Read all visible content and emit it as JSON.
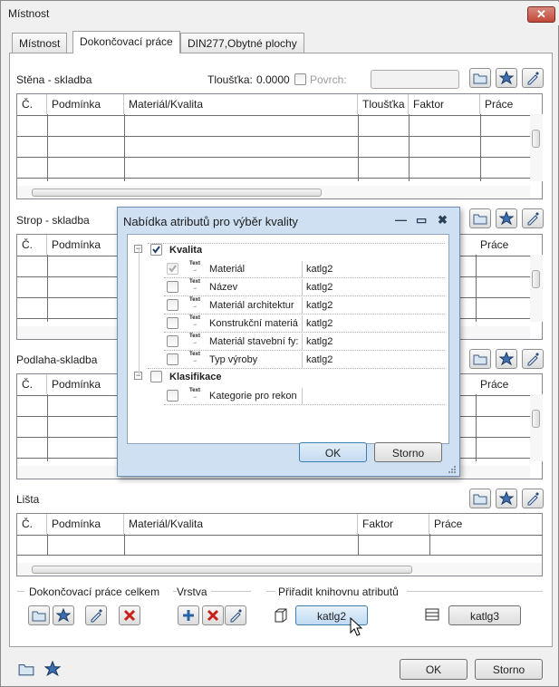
{
  "window": {
    "title": "Místnost",
    "close_glyph": "✕"
  },
  "tabs": [
    {
      "label": "Místnost",
      "active": false
    },
    {
      "label": "Dokončovací práce",
      "active": true
    },
    {
      "label": "DIN277,Obytné plochy",
      "active": false
    }
  ],
  "wall": {
    "title": "Stěna - skladba",
    "thickness_label": "Tloušťka:",
    "thickness_value": "0.0000",
    "surface_label": "Povrch:",
    "columns": [
      "Č.",
      "Podmínka",
      "Materiál/Kvalita",
      "Tloušťka",
      "Faktor",
      "Práce"
    ]
  },
  "ceiling": {
    "title": "Strop - skladba",
    "columns": [
      "Č.",
      "Podmínka",
      "Práce"
    ]
  },
  "floor": {
    "title": "Podlaha-skladba",
    "columns": [
      "Č.",
      "Podmínka",
      "Práce"
    ]
  },
  "skirting": {
    "title": "Lišta",
    "columns": [
      "Č.",
      "Podmínka",
      "Materiál/Kvalita",
      "Faktor",
      "Práce"
    ]
  },
  "groups": {
    "total": "Dokončovací práce celkem",
    "layer": "Vrstva",
    "library": "Přiřadit knihovnu atributů"
  },
  "library_buttons": {
    "first": "katlg2",
    "second": "katlg3"
  },
  "footer": {
    "ok": "OK",
    "cancel": "Storno"
  },
  "dialog": {
    "title": "Nabídka atributů pro výběr kvality",
    "icon_min": "—",
    "icon_max": "▭",
    "icon_close": "✖",
    "group1": {
      "label": "Kvalita",
      "checked": true
    },
    "items": [
      {
        "label": "Materiál",
        "value": "katlg2",
        "checked": true,
        "disabled": true
      },
      {
        "label": "Název",
        "value": "katlg2",
        "checked": false,
        "disabled": false
      },
      {
        "label": "Materiál architektur",
        "value": "katlg2",
        "checked": false,
        "disabled": false
      },
      {
        "label": "Konstrukční materiá",
        "value": "katlg2",
        "checked": false,
        "disabled": false
      },
      {
        "label": "Materiál stavební fy:",
        "value": "katlg2",
        "checked": false,
        "disabled": false
      },
      {
        "label": "Typ výroby",
        "value": "katlg2",
        "checked": false,
        "disabled": false
      }
    ],
    "group2": {
      "label": "Klasifikace",
      "checked": false
    },
    "items2": [
      {
        "label": "Kategorie pro rekon",
        "value": "",
        "checked": false,
        "disabled": false
      }
    ],
    "text_icon": "Text",
    "ok": "OK",
    "cancel": "Storno"
  },
  "colors": {
    "accent": "#3a6ea5",
    "dialog_bg": "#cfe0f3"
  }
}
